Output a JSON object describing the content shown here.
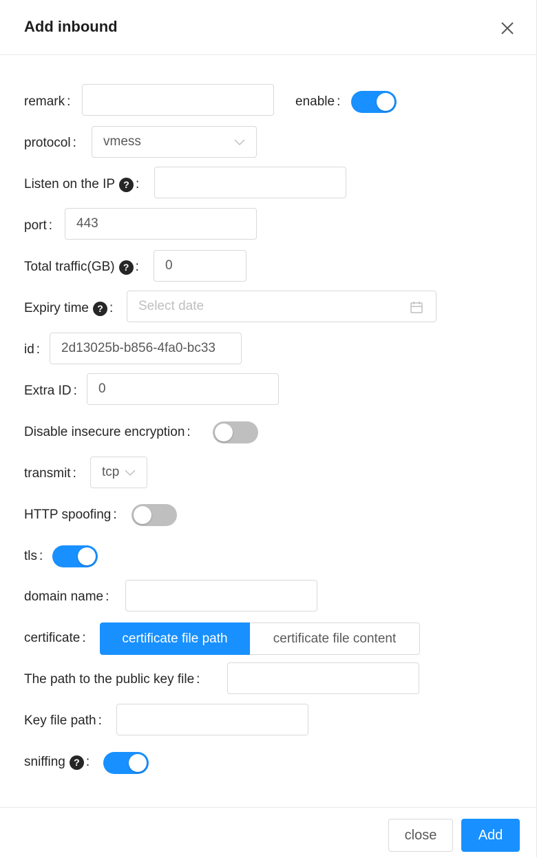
{
  "dialog": {
    "title": "Add inbound",
    "close_label": "close",
    "add_label": "Add"
  },
  "colon": ":",
  "help_glyph": "?",
  "fields": {
    "remark": {
      "label": "remark",
      "value": ""
    },
    "enable": {
      "label": "enable",
      "on": true
    },
    "protocol": {
      "label": "protocol",
      "value": "vmess"
    },
    "listen_ip": {
      "label": "Listen on the IP",
      "value": ""
    },
    "port": {
      "label": "port",
      "value": "443"
    },
    "total_traffic": {
      "label": "Total traffic(GB)",
      "value": "0"
    },
    "expiry_time": {
      "label": "Expiry time",
      "placeholder": "Select date"
    },
    "id": {
      "label": "id",
      "value": "2d13025b-b856-4fa0-bc33"
    },
    "extra_id": {
      "label": "Extra ID",
      "value": "0"
    },
    "disable_insecure": {
      "label": "Disable insecure encryption",
      "on": false
    },
    "transmit": {
      "label": "transmit",
      "value": "tcp"
    },
    "http_spoofing": {
      "label": "HTTP spoofing",
      "on": false
    },
    "tls": {
      "label": "tls",
      "on": true
    },
    "domain_name": {
      "label": "domain name",
      "value": ""
    },
    "certificate": {
      "label": "certificate",
      "options": [
        "certificate file path",
        "certificate file content"
      ],
      "selected": "certificate file path"
    },
    "public_key_path": {
      "label": "The path to the public key file",
      "value": ""
    },
    "key_file_path": {
      "label": "Key file path",
      "value": ""
    },
    "sniffing": {
      "label": "sniffing",
      "on": true
    }
  },
  "colors": {
    "primary": "#1890ff",
    "switch_off": "#bfbfbf",
    "border": "#d9d9d9"
  },
  "icons": {
    "close": "close-icon",
    "dropdown": "chevron-down-icon",
    "calendar": "calendar-icon",
    "help": "question-circle-icon"
  }
}
